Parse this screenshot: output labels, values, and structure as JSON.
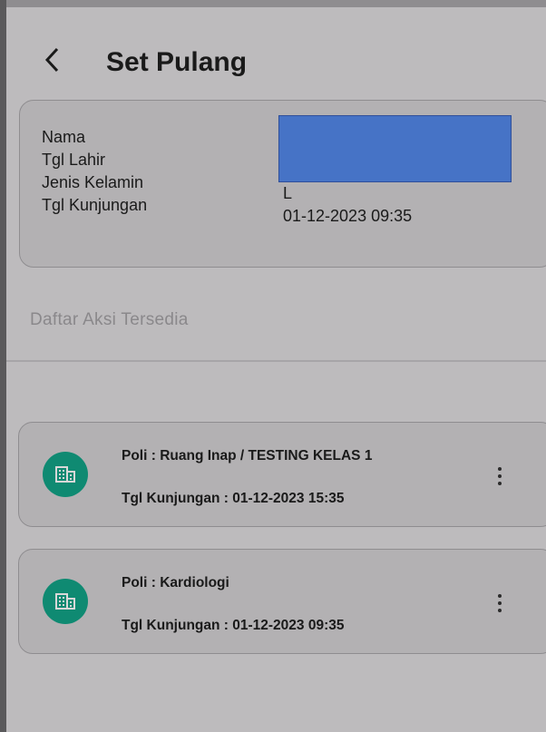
{
  "header": {
    "title": "Set Pulang",
    "back_icon": "chevron-left-icon"
  },
  "patient": {
    "labels": [
      "Nama",
      "Tgl Lahir",
      "Jenis Kelamin",
      "Tgl Kunjungan"
    ],
    "jenis_kelamin": "L",
    "tgl_kunjungan": "01-12-2023 09:35"
  },
  "section": {
    "title": "Daftar Aksi Tersedia"
  },
  "visits": [
    {
      "poli": "Poli : Ruang Inap / TESTING KELAS 1",
      "tgl": "Tgl Kunjungan : 01-12-2023 15:35",
      "icon": "building-icon"
    },
    {
      "poli": "Poli : Kardiologi",
      "tgl": "Tgl Kunjungan : 01-12-2023 09:35",
      "icon": "building-icon"
    }
  ],
  "colors": {
    "avatar": "#0f8a72",
    "redaction": "#4673c6",
    "background": "#bdbbbd"
  }
}
